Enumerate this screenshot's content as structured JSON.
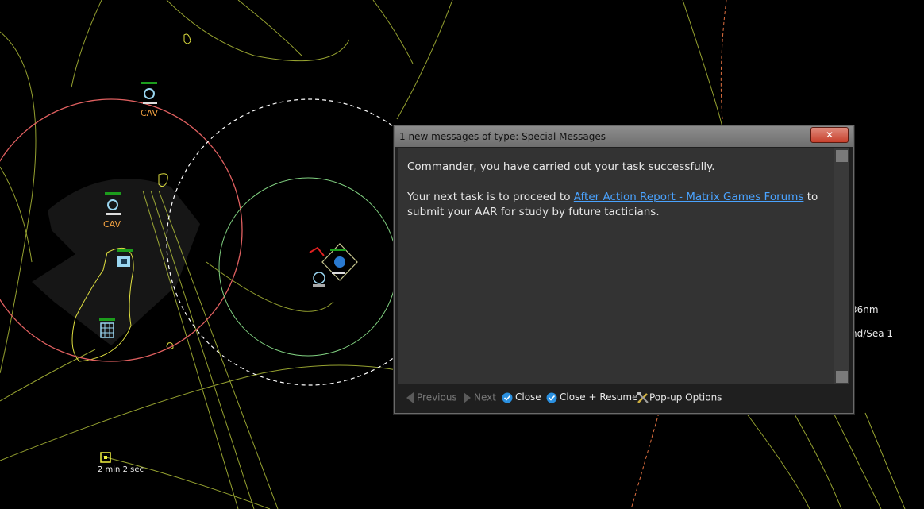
{
  "map": {
    "units": [
      {
        "label": "CAV"
      },
      {
        "label": "CAV"
      }
    ],
    "timer_label": "2 min 2 sec",
    "side_info_line1": "36nm",
    "side_info_line2": "nd/Sea 1"
  },
  "dialog": {
    "title": "1 new messages of type: Special Messages",
    "close_glyph": "✕",
    "message_line1": "Commander, you have carried out your task successfully.",
    "message_line2_pre": "Your next task is to proceed to ",
    "message_link": "After Action Report - Matrix Games Forums",
    "message_line2_post": " to submit your AAR for study by future tacticians."
  },
  "toolbar": {
    "previous_label": "Previous",
    "next_label": "Next",
    "close_label": "Close",
    "close_resume_label": "Close + Resume",
    "popup_options_label": "Pop-up Options"
  },
  "colors": {
    "range_ring_red": "#e06060",
    "range_ring_green": "#80d080",
    "lines_yellow": "#c8d840",
    "lines_green": "#a0d880",
    "dashed_white": "#ffffff",
    "link_blue": "#4aa3ff"
  },
  "icons": [
    "radar-icon",
    "airbase-icon",
    "facility-icon",
    "aircraft-icon",
    "check-circle-icon",
    "tools-icon",
    "arrow-left-icon",
    "arrow-right-icon"
  ]
}
